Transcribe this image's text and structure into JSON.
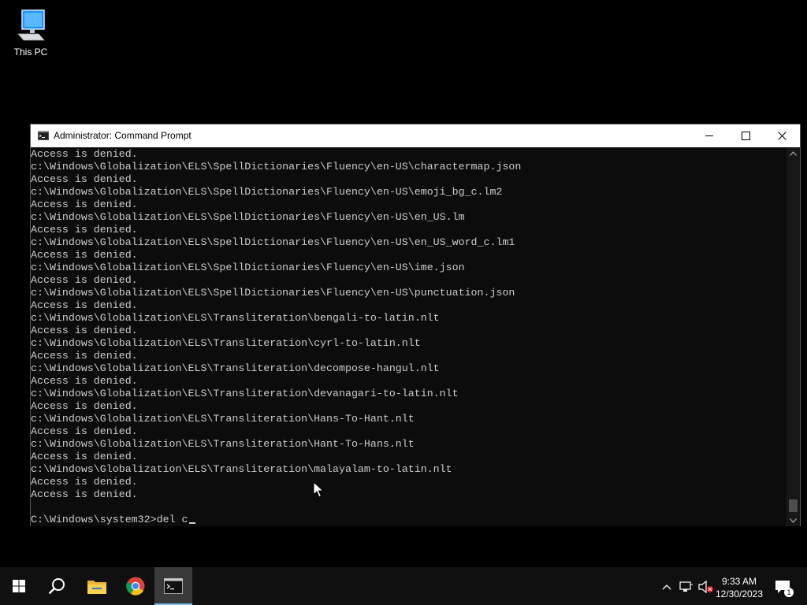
{
  "desktop": {
    "icons": [
      {
        "label": "This PC",
        "icon": "computer-icon"
      }
    ]
  },
  "window": {
    "title": "Administrator: Command Prompt",
    "controls": {
      "minimize": "minimize-icon",
      "maximize": "maximize-icon",
      "close": "close-icon"
    }
  },
  "console": {
    "lines": [
      "Access is denied.",
      "c:\\Windows\\Globalization\\ELS\\SpellDictionaries\\Fluency\\en-US\\charactermap.json",
      "Access is denied.",
      "c:\\Windows\\Globalization\\ELS\\SpellDictionaries\\Fluency\\en-US\\emoji_bg_c.lm2",
      "Access is denied.",
      "c:\\Windows\\Globalization\\ELS\\SpellDictionaries\\Fluency\\en-US\\en_US.lm",
      "Access is denied.",
      "c:\\Windows\\Globalization\\ELS\\SpellDictionaries\\Fluency\\en-US\\en_US_word_c.lm1",
      "Access is denied.",
      "c:\\Windows\\Globalization\\ELS\\SpellDictionaries\\Fluency\\en-US\\ime.json",
      "Access is denied.",
      "c:\\Windows\\Globalization\\ELS\\SpellDictionaries\\Fluency\\en-US\\punctuation.json",
      "Access is denied.",
      "c:\\Windows\\Globalization\\ELS\\Transliteration\\bengali-to-latin.nlt",
      "Access is denied.",
      "c:\\Windows\\Globalization\\ELS\\Transliteration\\cyrl-to-latin.nlt",
      "Access is denied.",
      "c:\\Windows\\Globalization\\ELS\\Transliteration\\decompose-hangul.nlt",
      "Access is denied.",
      "c:\\Windows\\Globalization\\ELS\\Transliteration\\devanagari-to-latin.nlt",
      "Access is denied.",
      "c:\\Windows\\Globalization\\ELS\\Transliteration\\Hans-To-Hant.nlt",
      "Access is denied.",
      "c:\\Windows\\Globalization\\ELS\\Transliteration\\Hant-To-Hans.nlt",
      "Access is denied.",
      "c:\\Windows\\Globalization\\ELS\\Transliteration\\malayalam-to-latin.nlt",
      "Access is denied.",
      "Access is denied."
    ],
    "prompt": "C:\\Windows\\system32>",
    "input_value": "del c"
  },
  "taskbar": {
    "items": [
      {
        "name": "start",
        "icon": "windows-start-icon"
      },
      {
        "name": "search",
        "icon": "search-icon"
      },
      {
        "name": "file-explorer",
        "icon": "folder-icon"
      },
      {
        "name": "chrome",
        "icon": "chrome-icon"
      },
      {
        "name": "command-prompt",
        "icon": "cmd-icon",
        "active": true
      }
    ],
    "tray": {
      "time": "9:33 AM",
      "date": "12/30/2023",
      "notification_count": "1"
    }
  },
  "colors": {
    "console_bg": "#0c0c0c",
    "console_text": "#cccccc",
    "taskbar_bg": "#101010",
    "accent": "#76b9ed"
  }
}
